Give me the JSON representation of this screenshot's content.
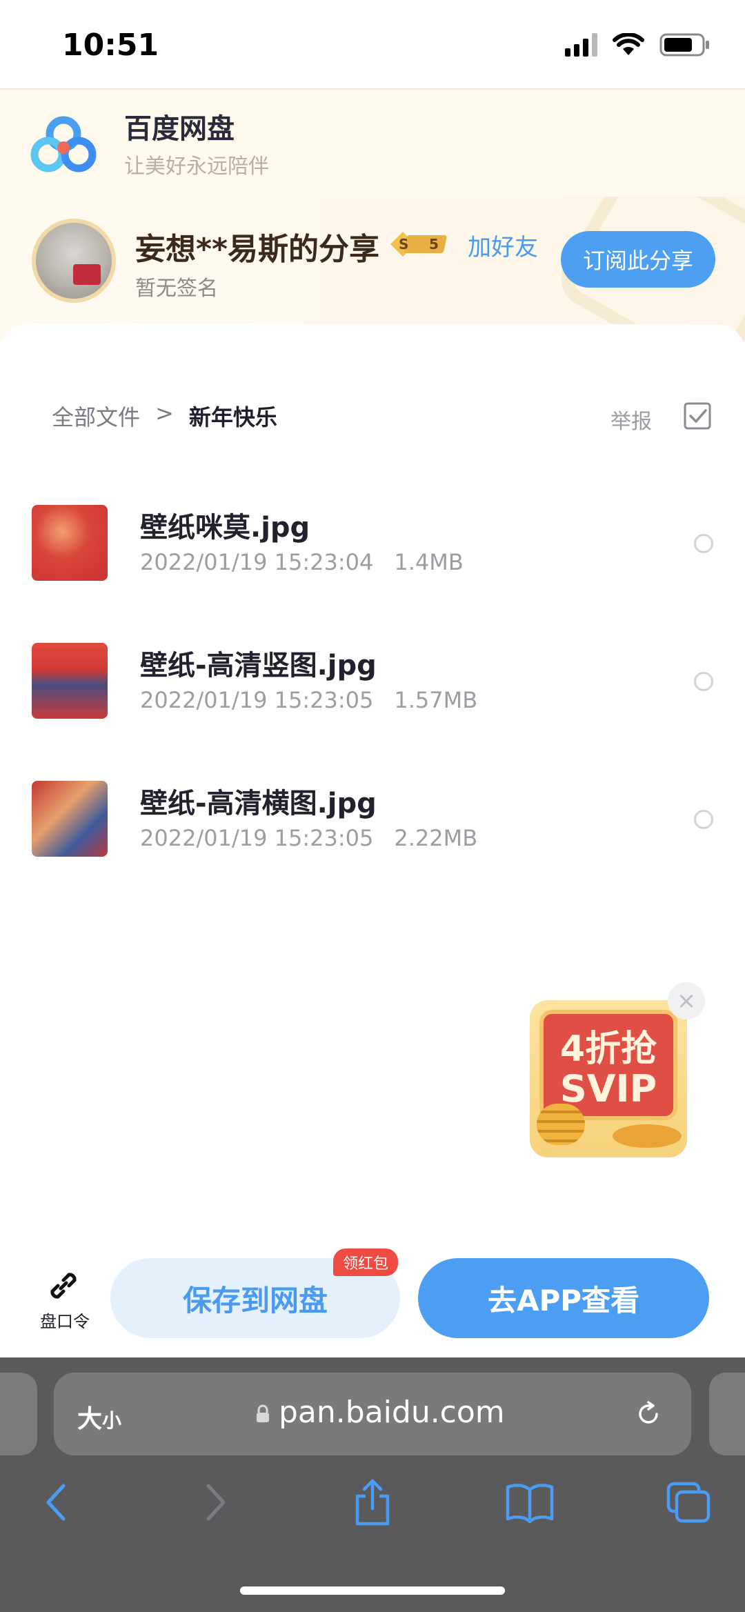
{
  "status_bar": {
    "time": "10:51"
  },
  "header": {
    "brand_name": "百度网盘",
    "slogan": "让美好永远陪伴"
  },
  "sharer": {
    "name": "妄想**易斯的分享",
    "level_badge": "5",
    "add_friend_label": "加好友",
    "signature": "暂无签名",
    "subscribe_label": "订阅此分享"
  },
  "breadcrumb": {
    "root": "全部文件",
    "separator": ">",
    "current": "新年快乐"
  },
  "report_label": "举报",
  "files": [
    {
      "name": "壁纸咪莫.jpg",
      "date": "2022/01/19 15:23:04",
      "size": "1.4MB"
    },
    {
      "name": "壁纸-高清竖图.jpg",
      "date": "2022/01/19 15:23:05",
      "size": "1.57MB"
    },
    {
      "name": "壁纸-高清横图.jpg",
      "date": "2022/01/19 15:23:05",
      "size": "2.22MB"
    }
  ],
  "promo": {
    "line1": "4折抢",
    "line2": "SVIP"
  },
  "action_bar": {
    "code_label": "盘口令",
    "save_label": "保存到网盘",
    "red_packet_badge": "领红包",
    "open_app_label": "去APP查看"
  },
  "browser": {
    "text_size_big": "大",
    "text_size_small": "小",
    "url": "pan.baidu.com"
  },
  "colors": {
    "accent": "#4c9ef3",
    "header_bg": "#fffaed",
    "badge_red": "#ee4b42",
    "browser_bg": "#5a5a5c"
  }
}
